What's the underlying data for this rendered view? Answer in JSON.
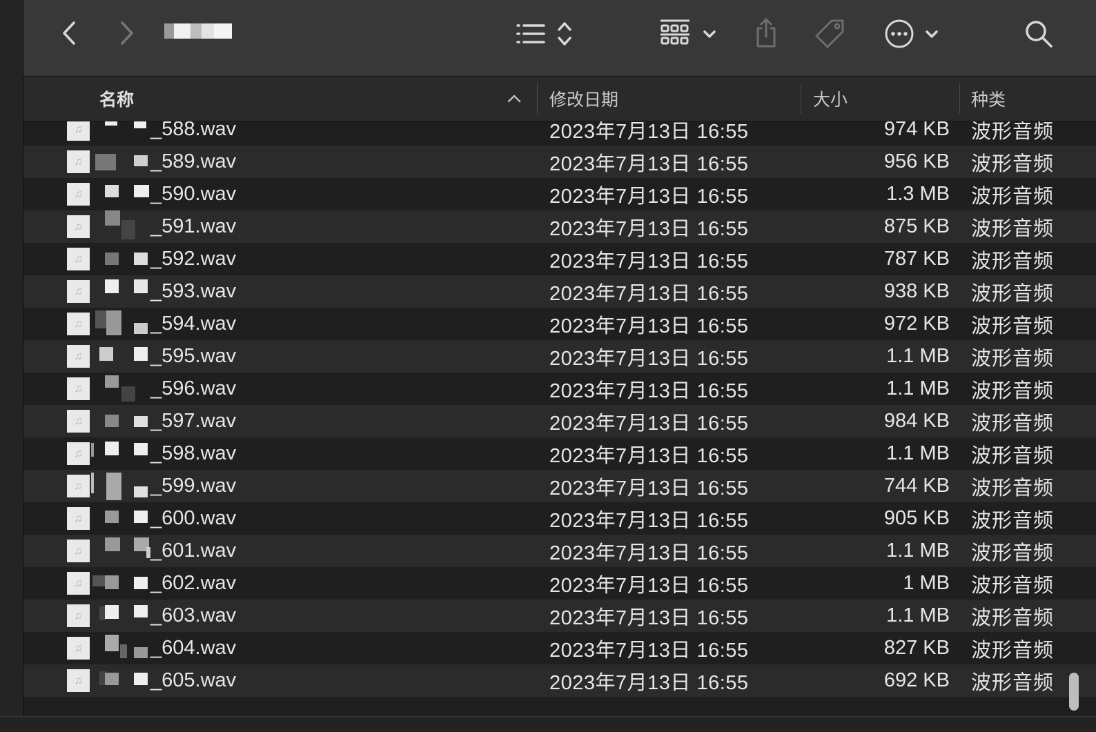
{
  "header": {
    "name": "名称",
    "date": "修改日期",
    "size": "大小",
    "kind": "种类"
  },
  "toolbar": {
    "icons": [
      "chevron-left",
      "chevron-right",
      "list-view",
      "sort-updown",
      "grid-view",
      "chevron-down",
      "share",
      "tag",
      "more-ellipsis",
      "chevron-down",
      "search"
    ]
  },
  "files": [
    {
      "name": "_588.wav",
      "date": "2023年7月13日 16:55",
      "size": "974 KB",
      "kind": "波形音频"
    },
    {
      "name": "_589.wav",
      "date": "2023年7月13日 16:55",
      "size": "956 KB",
      "kind": "波形音频"
    },
    {
      "name": "_590.wav",
      "date": "2023年7月13日 16:55",
      "size": "1.3 MB",
      "kind": "波形音频"
    },
    {
      "name": "_591.wav",
      "date": "2023年7月13日 16:55",
      "size": "875 KB",
      "kind": "波形音频"
    },
    {
      "name": "_592.wav",
      "date": "2023年7月13日 16:55",
      "size": "787 KB",
      "kind": "波形音频"
    },
    {
      "name": "_593.wav",
      "date": "2023年7月13日 16:55",
      "size": "938 KB",
      "kind": "波形音频"
    },
    {
      "name": "_594.wav",
      "date": "2023年7月13日 16:55",
      "size": "972 KB",
      "kind": "波形音频"
    },
    {
      "name": "_595.wav",
      "date": "2023年7月13日 16:55",
      "size": "1.1 MB",
      "kind": "波形音频"
    },
    {
      "name": "_596.wav",
      "date": "2023年7月13日 16:55",
      "size": "1.1 MB",
      "kind": "波形音频"
    },
    {
      "name": "_597.wav",
      "date": "2023年7月13日 16:55",
      "size": "984 KB",
      "kind": "波形音频"
    },
    {
      "name": "_598.wav",
      "date": "2023年7月13日 16:55",
      "size": "1.1 MB",
      "kind": "波形音频"
    },
    {
      "name": "_599.wav",
      "date": "2023年7月13日 16:55",
      "size": "744 KB",
      "kind": "波形音频"
    },
    {
      "name": "_600.wav",
      "date": "2023年7月13日 16:55",
      "size": "905 KB",
      "kind": "波形音频"
    },
    {
      "name": "_601.wav",
      "date": "2023年7月13日 16:55",
      "size": "1.1 MB",
      "kind": "波形音频"
    },
    {
      "name": "_602.wav",
      "date": "2023年7月13日 16:55",
      "size": "1 MB",
      "kind": "波形音频"
    },
    {
      "name": "_603.wav",
      "date": "2023年7月13日 16:55",
      "size": "1.1 MB",
      "kind": "波形音频"
    },
    {
      "name": "_604.wav",
      "date": "2023年7月13日 16:55",
      "size": "827 KB",
      "kind": "波形音频"
    },
    {
      "name": "_605.wav",
      "date": "2023年7月13日 16:55",
      "size": "692 KB",
      "kind": "波形音频"
    }
  ]
}
